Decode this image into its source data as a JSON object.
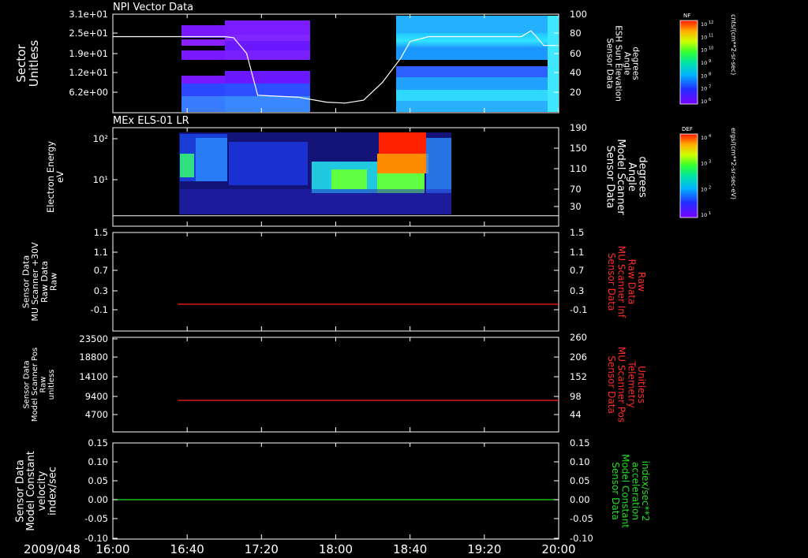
{
  "date_label": "2009/048",
  "time_axis": {
    "start": "16:00",
    "end": "20:00",
    "ticks": [
      "16:00",
      "16:40",
      "17:20",
      "18:00",
      "18:40",
      "19:20",
      "20:00"
    ]
  },
  "colors": {
    "background": "#000000",
    "axis": "#ffffff",
    "red_trace": "#ff2020",
    "green_trace": "#20e020",
    "right_red_label": "#ff2a2a",
    "right_green_label": "#22dd22"
  },
  "colorbars": [
    {
      "tag": "NF",
      "exponent_ticks": [
        "12",
        "11",
        "10",
        "9",
        "8",
        "7",
        "6"
      ],
      "unit": "cnts/(cm**2-sr-sec)"
    },
    {
      "tag": "DEF",
      "exponent_ticks": [
        "4",
        "3",
        "2",
        "1"
      ],
      "unit": "ergs/(cm**2-sr-sec-eV)"
    }
  ],
  "chart_data": [
    {
      "type": "heatmap",
      "title": "NPI Vector Data",
      "ylabel": [
        "Sector",
        "Unitless"
      ],
      "yticks": [
        "3.1e+01",
        "2.5e+01",
        "1.9e+01",
        "1.2e+01",
        "6.2e+00"
      ],
      "right_label": [
        "Sensor Data",
        "ESH Sun Elevation",
        "Angle",
        "degrees"
      ],
      "right_yticks": [
        "100",
        "80",
        "60",
        "40",
        "20"
      ],
      "right_ylim": [
        0,
        100
      ],
      "data_segments_hhmm": [
        [
          "16:38",
          "16:58"
        ],
        [
          "16:58",
          "17:40"
        ],
        [
          "18:26",
          "20:00"
        ]
      ],
      "sun_elevation_line": {
        "x": [
          "16:00",
          "16:30",
          "17:00",
          "17:05",
          "17:12",
          "17:18",
          "17:40",
          "17:55",
          "18:05",
          "18:15",
          "18:25",
          "18:35",
          "18:40",
          "18:50",
          "19:00",
          "19:20",
          "19:40",
          "19:45",
          "19:48",
          "19:52",
          "20:00"
        ],
        "y": [
          77,
          77,
          77,
          76,
          60,
          17,
          15,
          10,
          9,
          12,
          30,
          55,
          72,
          77,
          77,
          77,
          77,
          83,
          77,
          68,
          68
        ]
      }
    },
    {
      "type": "heatmap",
      "title": "MEx ELS-01 LR",
      "ylabel": [
        "Electron Energy",
        "eV"
      ],
      "yticks": [
        "10²",
        "10¹"
      ],
      "right_label": [
        "Sensor Data",
        "Model Scanner",
        "Angle",
        "degrees"
      ],
      "right_yticks": [
        "190",
        "150",
        "110",
        "70",
        "30"
      ],
      "right_ylim": [
        0,
        190
      ],
      "data_range_hhmm": [
        "16:37",
        "19:00"
      ],
      "scanner_angle_line": {
        "x": [
          "16:00",
          "20:00"
        ],
        "y": [
          5,
          5
        ]
      }
    },
    {
      "type": "line",
      "ylabel": [
        "Sensor Data",
        "MU Scanner +30V",
        "Raw Data",
        "Raw"
      ],
      "yticks": [
        "1.5",
        "1.1",
        "0.7",
        "0.3",
        "-0.1"
      ],
      "ylim": [
        -0.3,
        1.5
      ],
      "right_label": [
        "Sensor Data",
        "MU Scanner Inf",
        "Raw Data",
        "Raw"
      ],
      "right_yticks": [
        "1.5",
        "1.1",
        "0.7",
        "0.3",
        "-0.1"
      ],
      "series": [
        {
          "x": [
            "16:35",
            "20:00"
          ],
          "values": [
            0.1,
            0.1
          ]
        }
      ]
    },
    {
      "type": "line",
      "ylabel": [
        "Sensor Data",
        "Model Scanner Pos",
        "Raw",
        "unitless"
      ],
      "yticks": [
        "23500",
        "18800",
        "14100",
        "9400",
        "4700"
      ],
      "ylim": [
        0,
        23500
      ],
      "right_label": [
        "Sensor Data",
        "MU Scanner Pos",
        "Telemetry",
        "Unitless"
      ],
      "right_yticks": [
        "260",
        "206",
        "152",
        "98",
        "44"
      ],
      "right_ylim": [
        0,
        260
      ],
      "series": [
        {
          "x": [
            "16:35",
            "20:00"
          ],
          "values": [
            8000,
            8000
          ]
        }
      ]
    },
    {
      "type": "line",
      "ylabel": [
        "Sensor Data",
        "Model Constant",
        "velocity",
        "index/sec"
      ],
      "yticks": [
        "0.15",
        "0.10",
        "0.05",
        "0.00",
        "-0.05",
        "-0.10"
      ],
      "ylim": [
        -0.1,
        0.15
      ],
      "right_label": [
        "Sensor Data",
        "Model Constant",
        "acceleration",
        "index/sec**2"
      ],
      "right_yticks": [
        "0.15",
        "0.10",
        "0.05",
        "0.00",
        "-0.05",
        "-0.10"
      ],
      "series": [
        {
          "x": [
            "16:00",
            "20:00"
          ],
          "values": [
            0.0,
            0.0
          ]
        }
      ]
    }
  ]
}
